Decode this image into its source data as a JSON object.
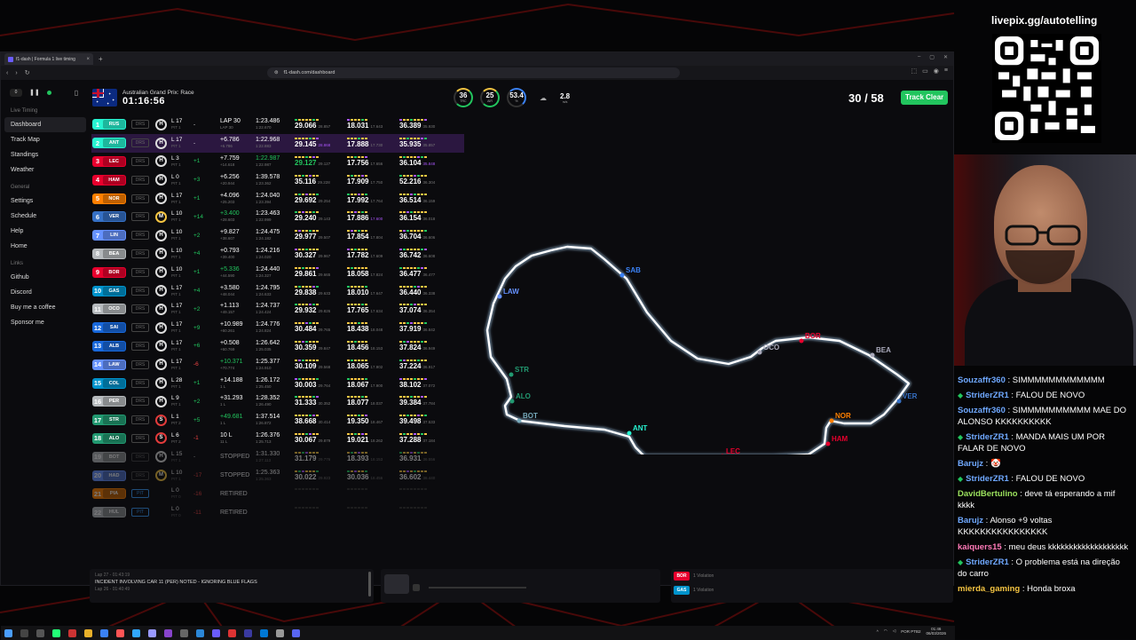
{
  "browser": {
    "tab_title": "f1-dash | Formula 1 live timing",
    "url": "f1-dash.com/dashboard"
  },
  "sidebar": {
    "live_timing_label": "Live Timing",
    "live_items": [
      "Dashboard",
      "Track Map",
      "Standings",
      "Weather"
    ],
    "general_label": "General",
    "general_items": [
      "Settings",
      "Schedule",
      "Help",
      "Home"
    ],
    "links_label": "Links",
    "links_items": [
      "Github",
      "Discord",
      "Buy me a coffee",
      "Sponsor me"
    ],
    "counter": "0"
  },
  "header": {
    "race_name": "Australian Grand Prix: Race",
    "elapsed": "01:16:56",
    "track_temp": "36",
    "track_temp_label": "TRC",
    "air_temp": "25",
    "air_temp_label": "AIR",
    "humidity": "53.4",
    "humidity_label": "%",
    "wind": "2.8",
    "wind_label": "m/s",
    "laps": "30 / 58",
    "track_status": "Track Clear",
    "accent": "#22c55e"
  },
  "drivers": [
    {
      "pos": "1",
      "code": "RUS",
      "color": "#27f4d2",
      "drs": "DRS",
      "tyre": "H",
      "tyre_type": "h",
      "lap": "L 17",
      "pit": "PIT 1",
      "delta": "-",
      "gap": "LAP 30",
      "gap2": "LAP 30",
      "lt": "1:23.486",
      "lt2": "1:22.670",
      "s1": "29.066",
      "s1b": "28.857",
      "s2": "18.031",
      "s2b": "17.643",
      "s3": "36.389",
      "s3b": "35.930"
    },
    {
      "pos": "2",
      "code": "ANT",
      "color": "#27f4d2",
      "drs": "DRS",
      "tyre": "H",
      "tyre_type": "h",
      "lap": "L 17",
      "pit": "PIT 1",
      "delta": "-",
      "gap": "+6.786",
      "gap2": "+6.786",
      "lt": "1:22.968",
      "lt2": "1:22.883",
      "s1": "29.145",
      "s1b": "28.868",
      "s2": "17.888",
      "s2b": "17.730",
      "s3": "35.935",
      "s3b": "35.857",
      "hl": true
    },
    {
      "pos": "3",
      "code": "LEC",
      "color": "#e8002d",
      "drs": "DRS",
      "tyre": "H",
      "tyre_type": "h",
      "lap": "L 3",
      "pit": "PIT 1",
      "delta": "+1",
      "gap": "+7.759",
      "gap2": "+14.618",
      "lt": "1:22.987",
      "lt2": "1:22.987",
      "s1": "29.127",
      "s1b": "29.127",
      "s2": "17.756",
      "s2b": "17.656",
      "s3": "36.104",
      "s3b": "35.848"
    },
    {
      "pos": "4",
      "code": "HAM",
      "color": "#e8002d",
      "drs": "DRS",
      "tyre": "H",
      "tyre_type": "h",
      "lap": "L 0",
      "pit": "PIT 1",
      "delta": "+3",
      "gap": "+6.256",
      "gap2": "+20.944",
      "lt": "1:39.578",
      "lt2": "1:23.362",
      "s1": "35.116",
      "s1b": "29.228",
      "s2": "17.909",
      "s2b": "17.750",
      "s3": "52.216",
      "s3b": "36.304"
    },
    {
      "pos": "5",
      "code": "NOR",
      "color": "#ff8000",
      "drs": "DRS",
      "tyre": "H",
      "tyre_type": "h",
      "lap": "L 17",
      "pit": "PIT 1",
      "delta": "+1",
      "gap": "+4.096",
      "gap2": "+25.203",
      "lt": "1:24.040",
      "lt2": "1:23.394",
      "s1": "29.692",
      "s1b": "29.254",
      "s2": "17.992",
      "s2b": "17.764",
      "s3": "36.514",
      "s3b": "36.159"
    },
    {
      "pos": "6",
      "code": "VER",
      "color": "#3671c6",
      "drs": "DRS",
      "tyre": "M",
      "tyre_type": "m",
      "lap": "L 10",
      "pit": "PIT 1",
      "delta": "+14",
      "gap": "+3.400",
      "gap2": "+28.603",
      "lt": "1:23.463",
      "lt2": "1:22.999",
      "s1": "29.240",
      "s1b": "29.143",
      "s2": "17.886",
      "s2b": "17.600",
      "s3": "36.154",
      "s3b": "36.018"
    },
    {
      "pos": "7",
      "code": "LIN",
      "color": "#6692ff",
      "drs": "DRS",
      "tyre": "H",
      "tyre_type": "h",
      "lap": "L 10",
      "pit": "PIT 1",
      "delta": "+2",
      "gap": "+9.827",
      "gap2": "+38.607",
      "lt": "1:24.475",
      "lt2": "1:24.182",
      "s1": "29.977",
      "s1b": "29.507",
      "s2": "17.854",
      "s2b": "17.804",
      "s3": "36.704",
      "s3b": "36.606"
    },
    {
      "pos": "8",
      "code": "BEA",
      "color": "#b6babd",
      "drs": "DRS",
      "tyre": "H",
      "tyre_type": "h",
      "lap": "L 10",
      "pit": "PIT 1",
      "delta": "+4",
      "gap": "+0.793",
      "gap2": "+39.400",
      "lt": "1:24.216",
      "lt2": "1:24.020",
      "s1": "30.327",
      "s1b": "29.967",
      "s2": "17.782",
      "s2b": "17.609",
      "s3": "36.742",
      "s3b": "36.608"
    },
    {
      "pos": "9",
      "code": "BOR",
      "color": "#e8002d",
      "drs": "DRS",
      "tyre": "H",
      "tyre_type": "h",
      "lap": "L 10",
      "pit": "PIT 1",
      "delta": "+1",
      "gap": "+5.336",
      "gap2": "+44.590",
      "lt": "1:24.440",
      "lt2": "1:24.327",
      "s1": "29.861",
      "s1b": "29.665",
      "s2": "18.058",
      "s2b": "17.824",
      "s3": "36.477",
      "s3b": "36.477"
    },
    {
      "pos": "10",
      "code": "GAS",
      "color": "#0093cc",
      "drs": "DRS",
      "tyre": "H",
      "tyre_type": "h",
      "lap": "L 17",
      "pit": "PIT 1",
      "delta": "+4",
      "gap": "+3.580",
      "gap2": "+48.044",
      "lt": "1:24.795",
      "lt2": "1:24.633",
      "s1": "29.838",
      "s1b": "29.633",
      "s2": "18.010",
      "s2b": "17.647",
      "s3": "36.440",
      "s3b": "36.338"
    },
    {
      "pos": "11",
      "code": "OCO",
      "color": "#b6babd",
      "drs": "DRS",
      "tyre": "H",
      "tyre_type": "h",
      "lap": "L 17",
      "pit": "PIT 1",
      "delta": "+2",
      "gap": "+1.113",
      "gap2": "+49.157",
      "lt": "1:24.737",
      "lt2": "1:24.424",
      "s1": "29.932",
      "s1b": "29.826",
      "s2": "17.765",
      "s2b": "17.634",
      "s3": "37.074",
      "s3b": "36.354"
    },
    {
      "pos": "12",
      "code": "SAI",
      "color": "#1868db",
      "drs": "DRS",
      "tyre": "H",
      "tyre_type": "h",
      "lap": "L 17",
      "pit": "PIT 1",
      "delta": "+9",
      "gap": "+10.989",
      "gap2": "+60.261",
      "lt": "1:24.776",
      "lt2": "1:24.824",
      "s1": "30.484",
      "s1b": "29.765",
      "s2": "18.438",
      "s2b": "18.048",
      "s3": "37.919",
      "s3b": "36.842"
    },
    {
      "pos": "13",
      "code": "ALB",
      "color": "#1868db",
      "drs": "DRS",
      "tyre": "H",
      "tyre_type": "h",
      "lap": "L 17",
      "pit": "PIT 1",
      "delta": "+6",
      "gap": "+0.508",
      "gap2": "+60.769",
      "lt": "1:26.642",
      "lt2": "1:25.035",
      "s1": "30.359",
      "s1b": "29.847",
      "s2": "18.456",
      "s2b": "18.153",
      "s3": "37.824",
      "s3b": "36.949"
    },
    {
      "pos": "14",
      "code": "LAW",
      "color": "#6692ff",
      "drs": "DRS",
      "tyre": "H",
      "tyre_type": "h",
      "lap": "L 17",
      "pit": "PIT 1",
      "delta": "-6",
      "gap": "+10.371",
      "gap2": "+70.774",
      "lt": "1:25.377",
      "lt2": "1:24.910",
      "s1": "30.109",
      "s1b": "29.568",
      "s2": "18.065",
      "s2b": "17.902",
      "s3": "37.224",
      "s3b": "36.917"
    },
    {
      "pos": "15",
      "code": "COL",
      "color": "#0093cc",
      "drs": "DRS",
      "tyre": "H",
      "tyre_type": "h",
      "lap": "L 28",
      "pit": "PIT 1",
      "delta": "+1",
      "gap": "+14.188",
      "gap2": "1 L",
      "lt": "1:26.172",
      "lt2": "1:25.450",
      "s1": "30.003",
      "s1b": "29.764",
      "s2": "18.067",
      "s2b": "17.900",
      "s3": "38.102",
      "s3b": "37.072"
    },
    {
      "pos": "16",
      "code": "PER",
      "color": "#b6babd",
      "drs": "DRS",
      "tyre": "H",
      "tyre_type": "h",
      "lap": "L 9",
      "pit": "PIT 1",
      "delta": "+2",
      "gap": "+31.293",
      "gap2": "1 L",
      "lt": "1:28.352",
      "lt2": "1:26.490",
      "s1": "31.333",
      "s1b": "30.352",
      "s2": "18.077",
      "s2b": "18.037",
      "s3": "39.384",
      "s3b": "37.784"
    },
    {
      "pos": "17",
      "code": "STR",
      "color": "#229971",
      "drs": "DRS",
      "tyre": "S",
      "tyre_type": "s",
      "lap": "L 1",
      "pit": "PIT 2",
      "delta": "+5",
      "gap": "+49.681",
      "gap2": "1 L",
      "lt": "1:37.514",
      "lt2": "1:26.872",
      "s1": "38.668",
      "s1b": "30.414",
      "s2": "19.350",
      "s2b": "18.467",
      "s3": "39.498",
      "s3b": "37.533"
    },
    {
      "pos": "18",
      "code": "ALO",
      "color": "#229971",
      "drs": "DRS",
      "tyre": "S",
      "tyre_type": "s",
      "lap": "L 6",
      "pit": "PIT 2",
      "delta": "-1",
      "gap": "10 L",
      "gap2": "11 L",
      "lt": "1:26.376",
      "lt2": "1:25.713",
      "s1": "30.067",
      "s1b": "29.879",
      "s2": "19.021",
      "s2b": "18.262",
      "s3": "37.288",
      "s3b": "37.184"
    },
    {
      "pos": "19",
      "code": "BOT",
      "color": "#b6babd",
      "drs": "DRS",
      "tyre": "H",
      "tyre_type": "h",
      "lap": "L 15",
      "pit": "PIT 1",
      "delta": "-",
      "gap": "STOPPED",
      "gap2": "",
      "lt": "1:31.330",
      "lt2": "1:27.113",
      "s1": "31.179",
      "s1b": "29.776",
      "s2": "18.393",
      "s2b": "18.153",
      "s3": "36.931",
      "s3b": "36.556",
      "dim": true
    },
    {
      "pos": "20",
      "code": "HAD",
      "color": "#6692ff",
      "drs": "DRS",
      "tyre": "M",
      "tyre_type": "m",
      "lap": "L 10",
      "pit": "PIT 1",
      "delta": "-17",
      "gap": "STOPPED",
      "gap2": "",
      "lt": "1:25.363",
      "lt2": "1:25.363",
      "s1": "30.022",
      "s1b": "29.923",
      "s2": "30.036",
      "s2b": "18.456",
      "s3": "36.602",
      "s3b": "36.440",
      "dim": true
    },
    {
      "pos": "21",
      "code": "PIA",
      "color": "#ff8000",
      "drs": "PIT",
      "tyre": "",
      "tyre_type": "x",
      "lap": "L 0",
      "pit": "PIT 0",
      "delta": "-16",
      "gap": "RETIRED",
      "gap2": "",
      "lt": "",
      "lt2": "",
      "s1": "",
      "s1b": "",
      "s2": "",
      "s2b": "",
      "s3": "",
      "s3b": "",
      "dim": true
    },
    {
      "pos": "22",
      "code": "HUL",
      "color": "#b6babd",
      "drs": "PIT",
      "tyre": "",
      "tyre_type": "x",
      "lap": "L 0",
      "pit": "PIT 0",
      "delta": "-11",
      "gap": "RETIRED",
      "gap2": "",
      "lt": "",
      "lt2": "",
      "s1": "",
      "s1b": "",
      "s2": "",
      "s2b": "",
      "s3": "",
      "s3b": "",
      "dim": true
    }
  ],
  "map_labels": [
    "SAB",
    "LAW",
    "STR",
    "ALO",
    "BOT",
    "ANT",
    "LEC",
    "HAM",
    "NOR",
    "BOR",
    "OCO",
    "BEA",
    "VER"
  ],
  "race_control": {
    "time1": "Lap 27 - 01:43:19",
    "message1": "INCIDENT INVOLVING CAR 11 (PER) NOTED - IGNORING BLUE FLAGS",
    "time2": "Lap 26 - 01:40:49"
  },
  "violations": [
    {
      "code": "BOR",
      "label": "1 Violation",
      "color": "#e8002d"
    },
    {
      "code": "GAS",
      "label": "1 Violation",
      "color": "#0093cc"
    }
  ],
  "taskbar": {
    "lang": "POR PTB2",
    "time": "01:46",
    "date": "06/03/2026"
  },
  "stream": {
    "handle": "livepix.gg/autotelling",
    "chat": [
      {
        "user": "Souzaffr360",
        "color": "#6fa8ff",
        "text": " : SIMMMMMMMMMMMM",
        "gem": false
      },
      {
        "user": "StriderZR1",
        "color": "#6fa8ff",
        "text": " : FALOU DE NOVO",
        "gem": true
      },
      {
        "user": "Souzaffr360",
        "color": "#6fa8ff",
        "text": " : SIMMMMMMMMMM MAE DO ALONSO KKKKKKKKKK",
        "gem": false
      },
      {
        "user": "StriderZR1",
        "color": "#6fa8ff",
        "text": " : MANDA MAIS UM POR FALAR DE NOVO",
        "gem": true
      },
      {
        "user": "Barujz",
        "color": "#6fa8ff",
        "text": " : 🤡",
        "gem": false
      },
      {
        "user": "StriderZR1",
        "color": "#6fa8ff",
        "text": " : FALOU DE NOVO",
        "gem": true
      },
      {
        "user": "DavidBertulino",
        "color": "#9be15d",
        "text": " : deve tá esperando a mif kkkk",
        "gem": false
      },
      {
        "user": "Barujz",
        "color": "#6fa8ff",
        "text": " : Alonso +9 voltas KKKKKKKKKKKKKKKK",
        "gem": false
      },
      {
        "user": "kaiquers15",
        "color": "#ff7ab8",
        "text": " : meu deus kkkkkkkkkkkkkkkkkkk",
        "gem": false
      },
      {
        "user": "StriderZR1",
        "color": "#6fa8ff",
        "text": " : O problema está na direção do carro",
        "gem": true
      },
      {
        "user": "mierda_gaming",
        "color": "#f5c542",
        "text": " : Honda broxa",
        "gem": false
      }
    ]
  }
}
